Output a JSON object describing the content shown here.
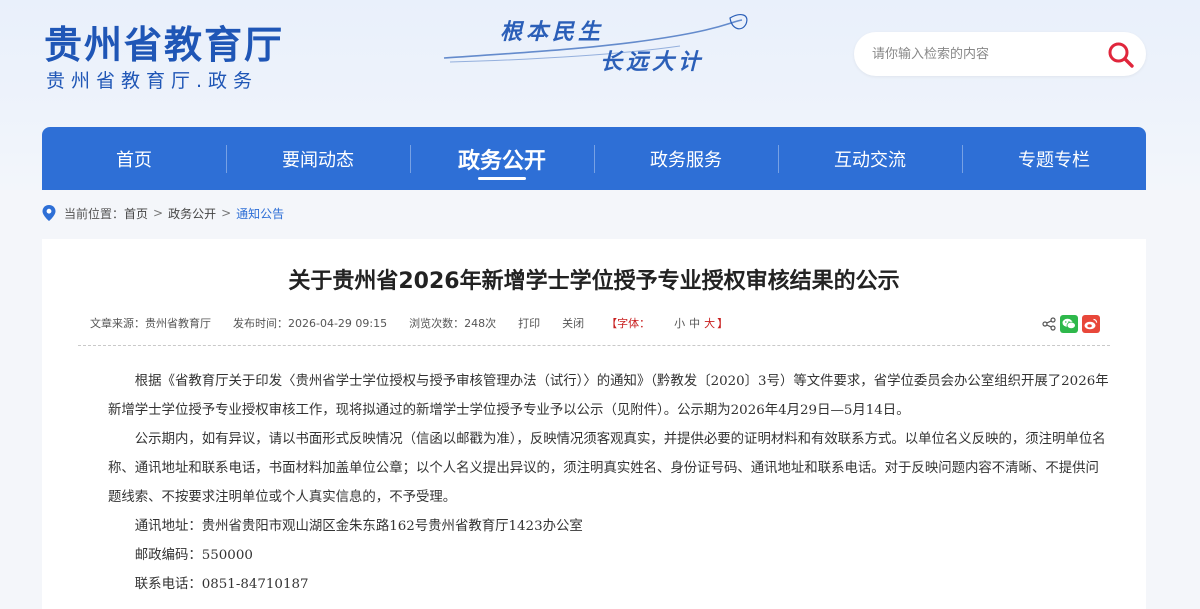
{
  "header": {
    "logo_title": "贵州省教育厅",
    "logo_subtitle": "贵州省教育厅.政务",
    "slogan_line1": "根本民生",
    "slogan_line2": "长远大计",
    "search_placeholder": "请你输入检索的内容"
  },
  "nav": {
    "items": [
      {
        "label": "首页",
        "active": false
      },
      {
        "label": "要闻动态",
        "active": false
      },
      {
        "label": "政务公开",
        "active": true
      },
      {
        "label": "政务服务",
        "active": false
      },
      {
        "label": "互动交流",
        "active": false
      },
      {
        "label": "专题专栏",
        "active": false
      }
    ]
  },
  "breadcrumb": {
    "prefix": "当前位置：",
    "items": [
      "首页",
      "政务公开",
      "通知公告"
    ],
    "separator": ">"
  },
  "article": {
    "title": "关于贵州省2026年新增学士学位授予专业授权审核结果的公示",
    "meta": {
      "source": "文章来源：贵州省教育厅",
      "time": "发布时间：2026-04-29 09:15",
      "views": "浏览次数：248次",
      "print": "打印",
      "close": "关闭",
      "font_prefix": "【字体：",
      "font_small": "小",
      "font_medium": "中",
      "font_large": "大",
      "font_suffix": "】"
    },
    "paragraphs": [
      "根据《省教育厅关于印发〈贵州省学士学位授权与授予审核管理办法（试行）〉的通知》（黔教发〔2020〕3号）等文件要求，省学位委员会办公室组织开展了2026年新增学士学位授予专业授权审核工作，现将拟通过的新增学士学位授予专业予以公示（见附件）。公示期为2026年4月29日—5月14日。",
      "公示期内，如有异议，请以书面形式反映情况（信函以邮戳为准），反映情况须客观真实，并提供必要的证明材料和有效联系方式。以单位名义反映的，须注明单位名称、通讯地址和联系电话，书面材料加盖单位公章；以个人名义提出异议的，须注明真实姓名、身份证号码、通讯地址和联系电话。对于反映问题内容不清晰、不提供问题线索、不按要求注明单位或个人真实信息的，不予受理。",
      "通讯地址：贵州省贵阳市观山湖区金朱东路162号贵州省教育厅1423办公室",
      "邮政编码：550000",
      "联系电话：0851-84710187"
    ]
  },
  "colors": {
    "brand_blue": "#1f56b6",
    "nav_blue": "#2e6fd6",
    "search_red": "#e0263c",
    "wechat_green": "#2eb84b",
    "weibo_red": "#e8473a"
  }
}
